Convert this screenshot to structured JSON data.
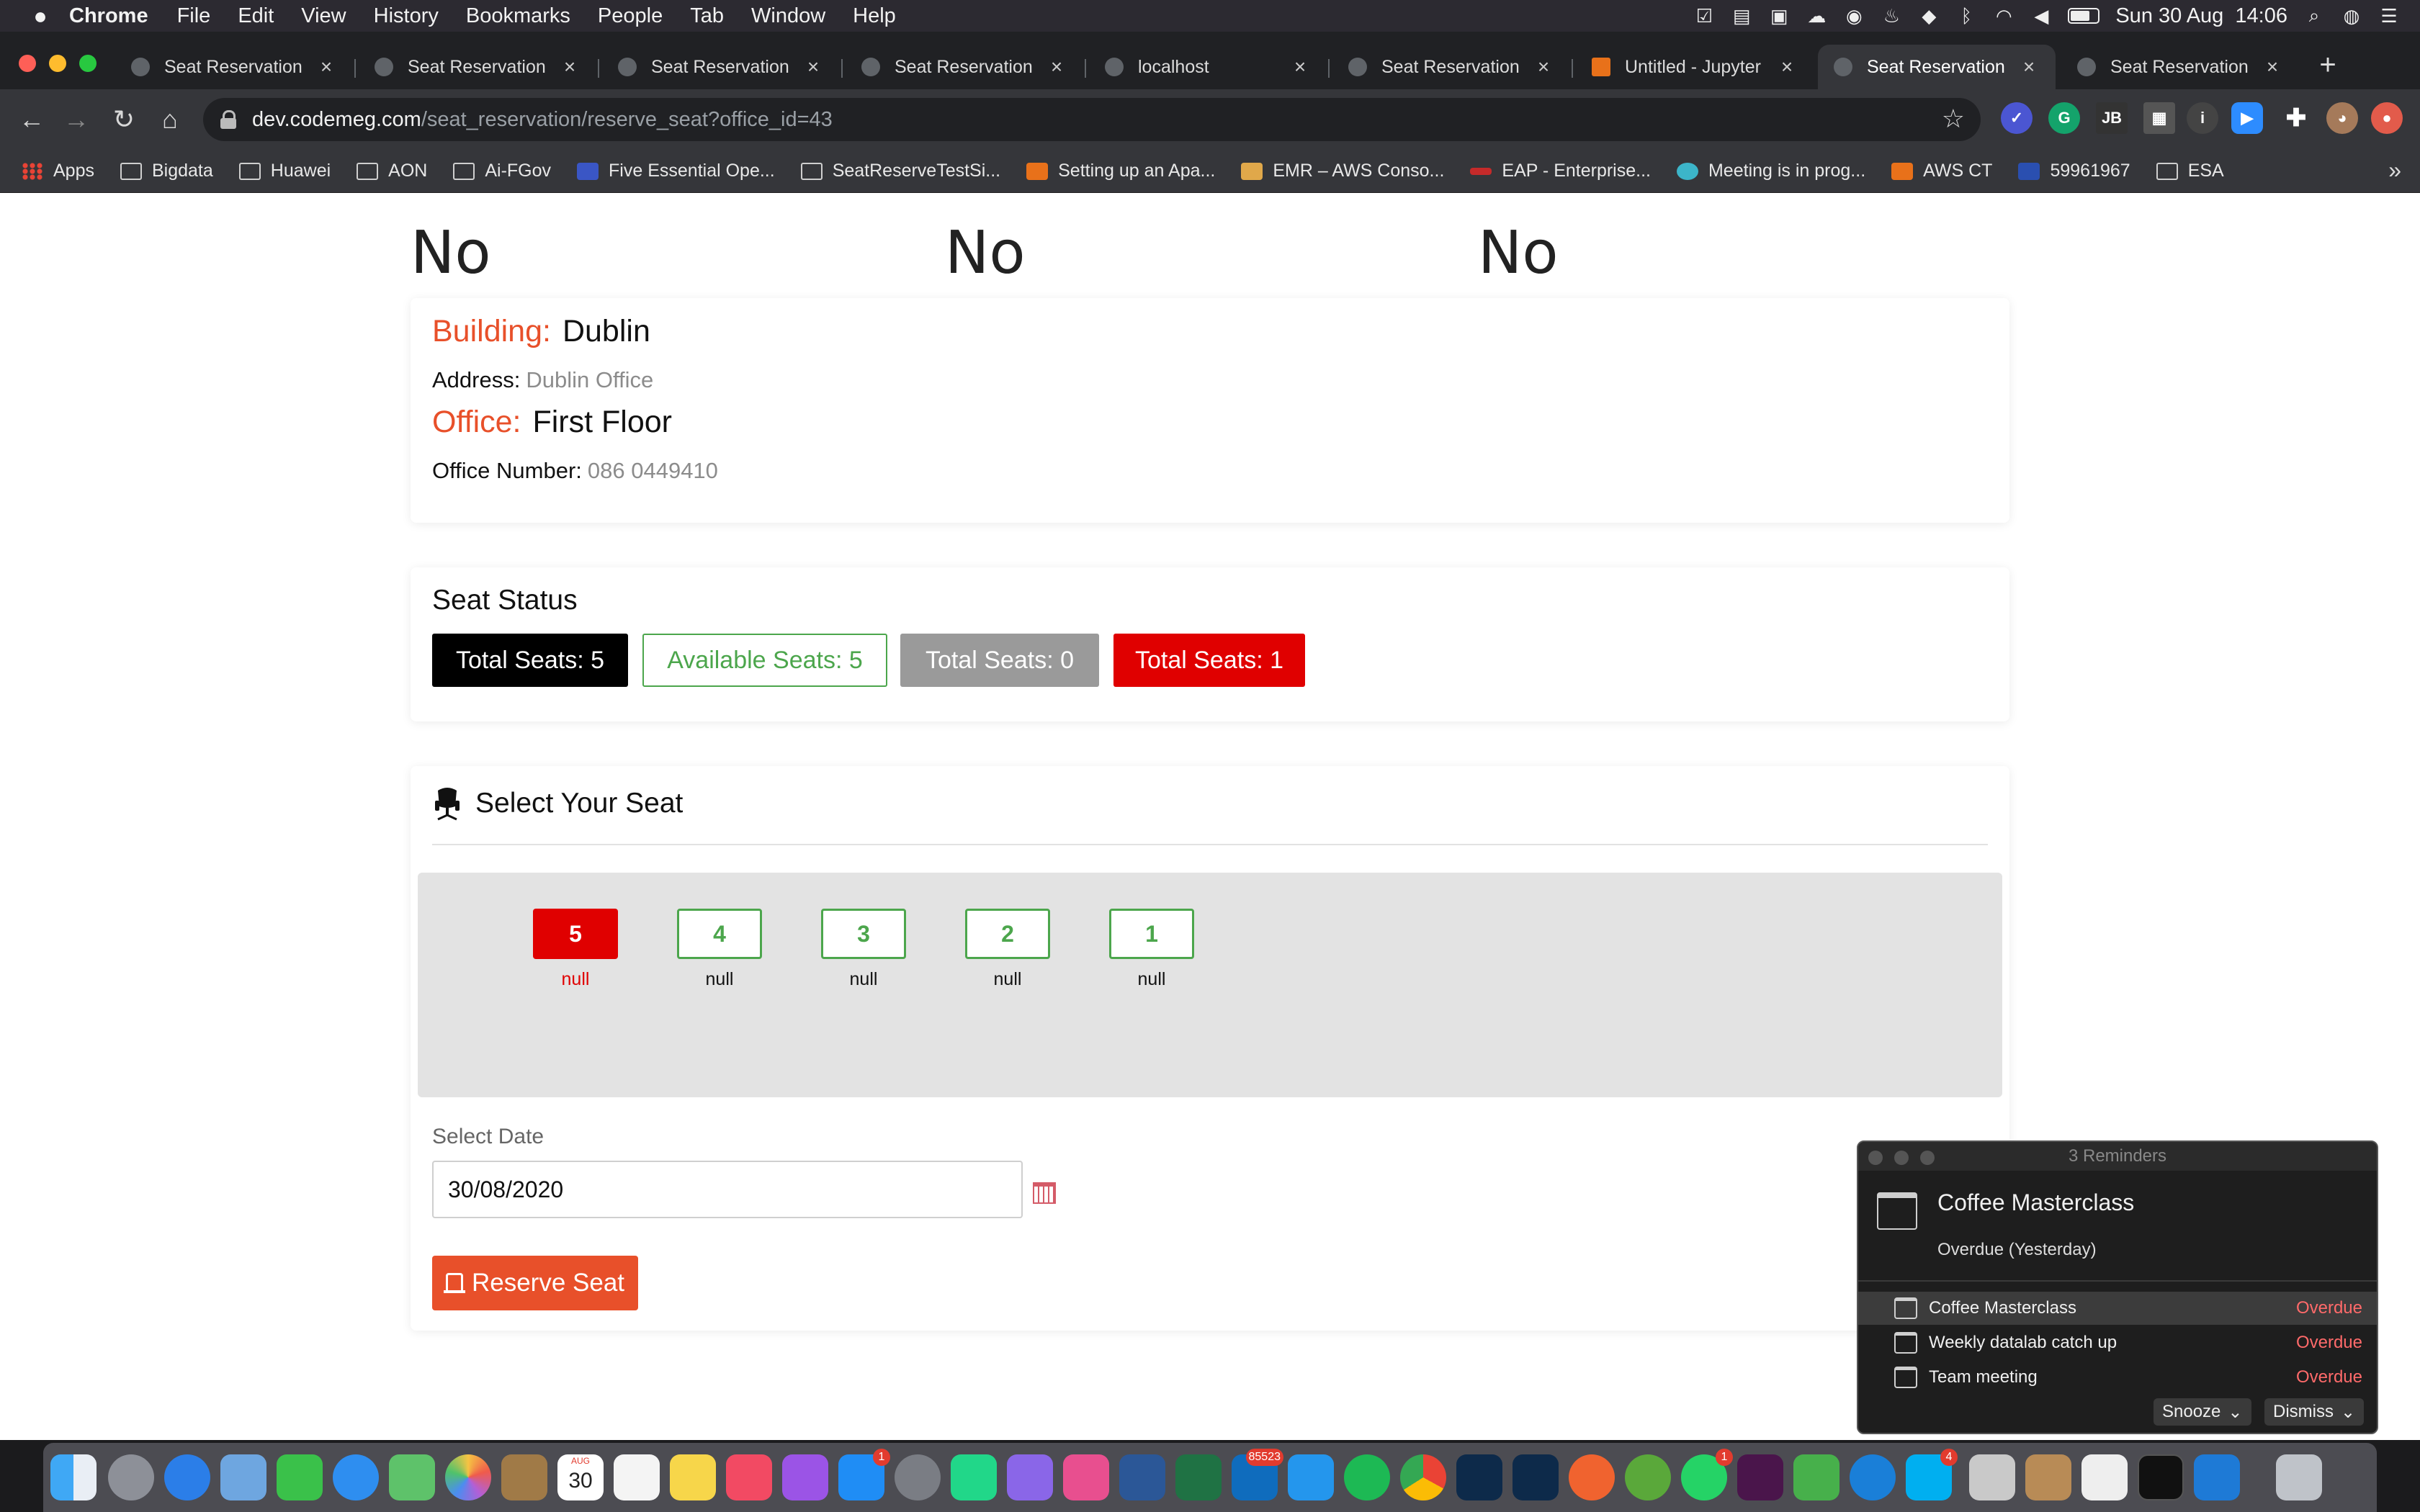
{
  "menubar": {
    "apple": "",
    "app_name": "Chrome",
    "items": [
      "File",
      "Edit",
      "View",
      "History",
      "Bookmarks",
      "People",
      "Tab",
      "Window",
      "Help"
    ],
    "datetime": "Sun 30 Aug  14:06"
  },
  "tabs": [
    {
      "title": "Seat Reservation"
    },
    {
      "title": "Seat Reservation"
    },
    {
      "title": "Seat Reservation"
    },
    {
      "title": "Seat Reservation"
    },
    {
      "title": "localhost"
    },
    {
      "title": "Seat Reservation"
    },
    {
      "title": "Untitled - Jupyter"
    },
    {
      "title": "Seat Reservation",
      "active": true
    },
    {
      "title": "Seat Reservation"
    }
  ],
  "tab_close": "×",
  "new_tab": "+",
  "address": {
    "host": "dev.codemeg.com",
    "path": "/seat_reservation/reserve_seat?office_id=43"
  },
  "bookmarks": [
    "Apps",
    "Bigdata",
    "Huawei",
    "AON",
    "Ai-FGov",
    "Five Essential Ope...",
    "SeatReserveTestSi...",
    "Setting up an Apa...",
    "EMR – AWS Conso...",
    "EAP - Enterprise...",
    "Meeting is in prog...",
    "AWS CT",
    "59961967",
    "ESA"
  ],
  "bookmarks_more": "»",
  "page": {
    "no_words": [
      "No",
      "No",
      "No"
    ],
    "building": {
      "building_label": "Building:",
      "building_value": "Dublin",
      "address_label": "Address:",
      "address_value": "Dublin Office",
      "office_label": "Office:",
      "office_value": "First Floor",
      "office_number_label": "Office Number:",
      "office_number_value": "086 0449410"
    },
    "seat_status": {
      "title": "Seat Status",
      "badges": [
        "Total Seats: 5",
        "Available Seats: 5",
        "Total Seats: 0",
        "Total Seats: 1"
      ]
    },
    "select_seat": {
      "title": "Select Your Seat",
      "seats": [
        {
          "number": "5",
          "caption": "null",
          "state": "taken"
        },
        {
          "number": "4",
          "caption": "null",
          "state": "free"
        },
        {
          "number": "3",
          "caption": "null",
          "state": "free"
        },
        {
          "number": "2",
          "caption": "null",
          "state": "free"
        },
        {
          "number": "1",
          "caption": "null",
          "state": "free"
        }
      ],
      "date_label": "Select Date",
      "date_value": "30/08/2020",
      "reserve_button": "Reserve Seat"
    }
  },
  "reminders": {
    "header": "3 Reminders",
    "main_title": "Coffee Masterclass",
    "main_subtitle": "Overdue (Yesterday)",
    "items": [
      {
        "name": "Coffee Masterclass",
        "status": "Overdue"
      },
      {
        "name": "Weekly datalab catch up",
        "status": "Overdue"
      },
      {
        "name": "Team meeting",
        "status": "Overdue"
      }
    ],
    "snooze_label": "Snooze",
    "dismiss_label": "Dismiss"
  },
  "dock": {
    "calendar_day": "30",
    "calendar_month": "AUG",
    "outlook_badge": "85523",
    "appstore_badge": "1",
    "whatsapp_badge": "1",
    "skype_badge": "4"
  },
  "colors": {
    "accent_orange": "#e8502a",
    "taken_red": "#e00000",
    "free_green": "#4ca64c"
  }
}
